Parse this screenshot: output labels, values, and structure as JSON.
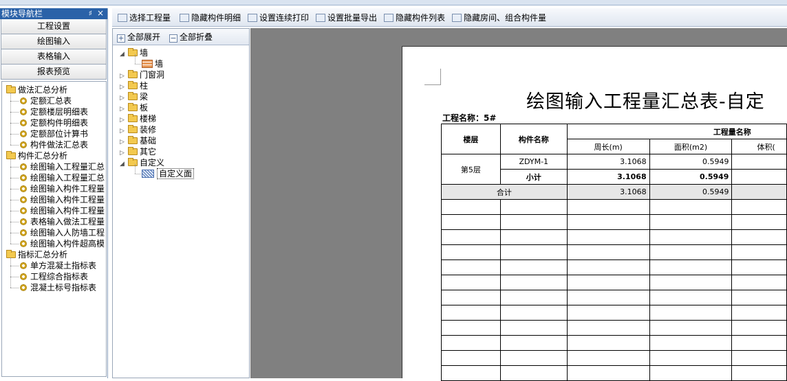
{
  "nav": {
    "title": "模块导航栏",
    "pin": "♯",
    "close": "×",
    "buttons": [
      "工程设置",
      "绘图输入",
      "表格输入",
      "报表预览"
    ],
    "tree": [
      {
        "label": "做法汇总分析",
        "children": [
          "定额汇总表",
          "定额楼层明细表",
          "定额构件明细表",
          "定额部位计算书",
          "构件做法汇总表"
        ]
      },
      {
        "label": "构件汇总分析",
        "children": [
          "绘图输入工程量汇总",
          "绘图输入工程量汇总",
          "绘图输入构件工程量",
          "绘图输入构件工程量",
          "绘图输入构件工程量",
          "表格输入做法工程量",
          "绘图输入人防墙工程",
          "绘图输入构件超高模"
        ]
      },
      {
        "label": "指标汇总分析",
        "children": [
          "单方混凝土指标表",
          "工程综合指标表",
          "混凝土标号指标表"
        ]
      }
    ]
  },
  "toolbar": {
    "items": [
      "选择工程量",
      "隐藏构件明细",
      "设置连续打印",
      "设置批量导出",
      "隐藏构件列表",
      "隐藏房间、组合构件量"
    ]
  },
  "treepanel": {
    "expand_all": "全部展开",
    "collapse_all": "全部折叠",
    "nodes": [
      {
        "label": "墙",
        "expanded": true,
        "children": [
          "墙"
        ]
      },
      {
        "label": "门窗洞"
      },
      {
        "label": "柱"
      },
      {
        "label": "梁"
      },
      {
        "label": "板"
      },
      {
        "label": "楼梯"
      },
      {
        "label": "装修"
      },
      {
        "label": "基础"
      },
      {
        "label": "其它"
      },
      {
        "label": "自定义",
        "expanded": true,
        "children": [
          "自定义面"
        ]
      }
    ]
  },
  "report": {
    "title": "绘图输入工程量汇总表-自定",
    "project_label": "工程名称：5#",
    "headers": {
      "floor": "楼层",
      "component": "构件名称",
      "quantity_name": "工程量名称",
      "perimeter": "周长(m)",
      "area": "面积(m2)",
      "volume": "体积("
    },
    "rows": [
      {
        "floor": "第5层",
        "component": "ZDYM-1",
        "perimeter": "3.1068",
        "area": "0.5949"
      },
      {
        "component": "小计",
        "perimeter": "3.1068",
        "area": "0.5949"
      }
    ],
    "total": {
      "label": "合计",
      "perimeter": "3.1068",
      "area": "0.5949"
    },
    "empty_rows": 12
  }
}
